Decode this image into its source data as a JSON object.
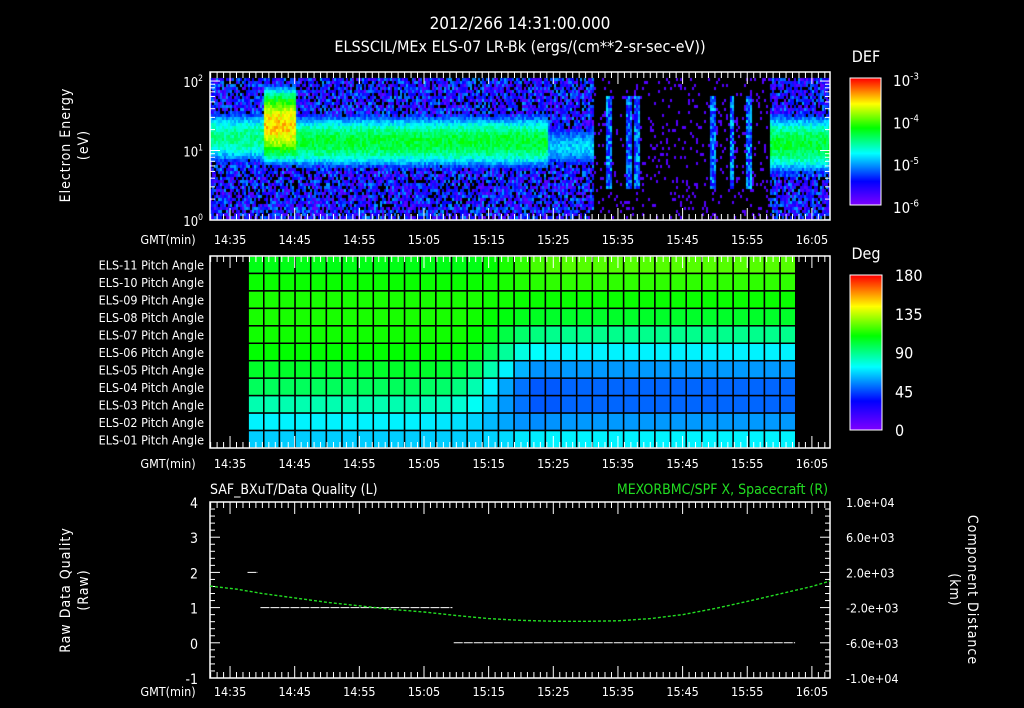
{
  "header": {
    "timestamp": "2012/266 14:31:00.000"
  },
  "colors": {
    "background": "#000000",
    "axis": "#ffffff",
    "spacecraft_line": "#22dd22",
    "quality_line": "#ffffff"
  },
  "time_axis": {
    "label": "GMT(min)",
    "range_min": [
      871.9,
      967.8
    ],
    "ticks": [
      {
        "value": 875,
        "label": "14:35"
      },
      {
        "value": 885,
        "label": "14:45"
      },
      {
        "value": 895,
        "label": "14:55"
      },
      {
        "value": 905,
        "label": "15:05"
      },
      {
        "value": 915,
        "label": "15:15"
      },
      {
        "value": 925,
        "label": "15:25"
      },
      {
        "value": 935,
        "label": "15:35"
      },
      {
        "value": 945,
        "label": "15:45"
      },
      {
        "value": 955,
        "label": "15:55"
      },
      {
        "value": 965,
        "label": "16:05"
      }
    ]
  },
  "chart_data": [
    {
      "type": "heatmap",
      "title": "ELSSCIL/MEx ELS-07 LR-Bk  (ergs/(cm**2-sr-sec-eV))",
      "ylabel": [
        "Electron Energy",
        "(eV)"
      ],
      "y_scale": "log",
      "y_range": [
        1,
        135
      ],
      "y_ticks": [
        {
          "value": 1,
          "base": "10",
          "exp": "0"
        },
        {
          "value": 10,
          "base": "10",
          "exp": "1"
        },
        {
          "value": 100,
          "base": "10",
          "exp": "2"
        }
      ],
      "colorbar": {
        "label": "DEF",
        "scale": "log",
        "range_log10": [
          -6,
          -3
        ],
        "ticks": [
          {
            "value": -3,
            "base": "10",
            "exp": "-3"
          },
          {
            "value": -4,
            "base": "10",
            "exp": "-4"
          },
          {
            "value": -5,
            "base": "10",
            "exp": "-5"
          },
          {
            "value": -6,
            "base": "10",
            "exp": "-6"
          }
        ]
      },
      "band_segments": [
        {
          "t": [
            871.9,
            880
          ],
          "peak_log_def": -4.5,
          "center_eV": 16,
          "width_dec": 0.28
        },
        {
          "t": [
            880,
            885
          ],
          "peak_log_def": -3.5,
          "center_eV": 24,
          "width_dec": 0.32
        },
        {
          "t": [
            885,
            924
          ],
          "peak_log_def": -4.3,
          "center_eV": 14,
          "width_dec": 0.27
        },
        {
          "t": [
            924,
            931
          ],
          "peak_log_def": -4.9,
          "center_eV": 12,
          "width_dec": 0.25
        },
        {
          "t": [
            958.5,
            967.8
          ],
          "peak_log_def": -4.3,
          "center_eV": 13,
          "width_dec": 0.3
        }
      ],
      "quiet_interval": [
        931,
        958.5
      ],
      "streaks_min": [
        933.5,
        936.5,
        937.8,
        949.5,
        952.5,
        955.2
      ]
    },
    {
      "type": "heatmap",
      "colorbar": {
        "label": "Deg",
        "range": [
          0,
          180
        ],
        "ticks": [
          "180",
          "135",
          "90",
          "45",
          "0"
        ]
      },
      "time_start_min": 877.8,
      "time_step_min": 2.42,
      "rows": [
        {
          "label": "ELS-11 Pitch Angle",
          "values": [
            107,
            107,
            107,
            107,
            107,
            107,
            107,
            107,
            107,
            107,
            107,
            107,
            107,
            107,
            107,
            110,
            113,
            116,
            119,
            121,
            121,
            121,
            121,
            121,
            121,
            121,
            121,
            121,
            121,
            121,
            121,
            121,
            121,
            121,
            121
          ]
        },
        {
          "label": "ELS-10 Pitch Angle",
          "values": [
            111,
            111,
            111,
            111,
            111,
            111,
            111,
            111,
            111,
            111,
            111,
            111,
            111,
            111,
            111,
            112,
            113,
            114,
            115,
            116,
            116,
            116,
            116,
            116,
            116,
            116,
            116,
            116,
            116,
            116,
            116,
            116,
            116,
            116,
            116
          ]
        },
        {
          "label": "ELS-09 Pitch Angle",
          "values": [
            113,
            113,
            113,
            113,
            113,
            113,
            113,
            113,
            113,
            113,
            113,
            113,
            113,
            113,
            113,
            112,
            112,
            111,
            111,
            111,
            111,
            111,
            111,
            111,
            111,
            111,
            111,
            111,
            111,
            111,
            111,
            111,
            111,
            111,
            111
          ]
        },
        {
          "label": "ELS-08 Pitch Angle",
          "values": [
            113,
            113,
            113,
            113,
            113,
            113,
            113,
            113,
            113,
            113,
            113,
            113,
            113,
            113,
            112,
            110,
            108,
            106,
            105,
            104,
            104,
            104,
            104,
            104,
            104,
            104,
            104,
            104,
            104,
            104,
            104,
            104,
            104,
            104,
            104
          ]
        },
        {
          "label": "ELS-07 Pitch Angle",
          "values": [
            112,
            112,
            112,
            112,
            112,
            112,
            112,
            112,
            112,
            112,
            112,
            112,
            112,
            112,
            110,
            106,
            100,
            95,
            92,
            90,
            90,
            90,
            90,
            90,
            90,
            90,
            90,
            90,
            90,
            90,
            90,
            90,
            90,
            90,
            90
          ]
        },
        {
          "label": "ELS-06 Pitch Angle",
          "values": [
            110,
            110,
            110,
            110,
            110,
            110,
            110,
            110,
            110,
            110,
            110,
            110,
            110,
            109,
            106,
            98,
            88,
            78,
            74,
            72,
            72,
            72,
            72,
            72,
            72,
            72,
            72,
            72,
            72,
            72,
            72,
            72,
            72,
            72,
            72
          ]
        },
        {
          "label": "ELS-05 Pitch Angle",
          "values": [
            104,
            104,
            104,
            104,
            104,
            104,
            104,
            104,
            104,
            104,
            104,
            104,
            103,
            101,
            96,
            85,
            72,
            62,
            57,
            57,
            58,
            58,
            58,
            58,
            58,
            58,
            58,
            58,
            58,
            58,
            58,
            58,
            58,
            58,
            58
          ]
        },
        {
          "label": "ELS-04 Pitch Angle",
          "values": [
            97,
            97,
            97,
            97,
            97,
            97,
            97,
            97,
            97,
            97,
            97,
            96,
            95,
            92,
            85,
            72,
            60,
            52,
            48,
            48,
            50,
            50,
            50,
            50,
            50,
            50,
            50,
            50,
            50,
            50,
            50,
            50,
            50,
            50,
            50
          ]
        },
        {
          "label": "ELS-03 Pitch Angle",
          "values": [
            85,
            85,
            85,
            85,
            85,
            85,
            85,
            85,
            85,
            85,
            85,
            84,
            83,
            80,
            75,
            66,
            58,
            52,
            48,
            48,
            50,
            50,
            50,
            50,
            50,
            50,
            50,
            50,
            50,
            50,
            50,
            50,
            50,
            50,
            50
          ]
        },
        {
          "label": "ELS-02 Pitch Angle",
          "values": [
            72,
            72,
            72,
            72,
            72,
            72,
            72,
            72,
            72,
            72,
            72,
            71,
            70,
            69,
            67,
            63,
            60,
            57,
            56,
            57,
            58,
            58,
            58,
            58,
            58,
            58,
            58,
            58,
            58,
            58,
            58,
            58,
            58,
            58,
            58
          ]
        },
        {
          "label": "ELS-01 Pitch Angle",
          "values": [
            66,
            66,
            66,
            66,
            66,
            66,
            66,
            66,
            66,
            66,
            66,
            66,
            66,
            66,
            66,
            67,
            68,
            70,
            71,
            72,
            72,
            72,
            72,
            72,
            72,
            72,
            72,
            72,
            72,
            72,
            72,
            72,
            72,
            72,
            72
          ]
        }
      ]
    },
    {
      "type": "line",
      "title_left": "SAF_BXuT/Data Quality (L)",
      "title_right": "MEXORBMC/SPF X, Spacecraft (R)",
      "ylabel_left": [
        "Raw Data Quality",
        "(Raw)"
      ],
      "ylabel_right": [
        "Component Distance",
        "(km)"
      ],
      "y_left_range": [
        -1,
        4
      ],
      "y_left_ticks": [
        "4",
        "3",
        "2",
        "1",
        "0",
        "-1"
      ],
      "y_right_range": [
        -10000,
        10000
      ],
      "y_right_ticks": [
        "1.0e+04",
        "6.0e+03",
        "2.0e+03",
        "-2.0e+03",
        "-6.0e+03",
        "-1.0e+04"
      ],
      "quality_segments": [
        {
          "t": [
            877.7,
            879.3
          ],
          "value": 2
        },
        {
          "t": [
            879.7,
            909.4
          ],
          "value": 1
        },
        {
          "t": [
            909.6,
            962.4
          ],
          "value": 0
        }
      ],
      "spacecraft_x": {
        "t": [
          871.9,
          876,
          880,
          885,
          890,
          895,
          900,
          905,
          910,
          915,
          920,
          925,
          930,
          935,
          940,
          945,
          950,
          955,
          960,
          965,
          967.8
        ],
        "km": [
          440,
          100,
          -400,
          -900,
          -1400,
          -1800,
          -2200,
          -2500,
          -2900,
          -3250,
          -3450,
          -3550,
          -3560,
          -3500,
          -3250,
          -2800,
          -2100,
          -1300,
          -450,
          400,
          1020
        ]
      }
    }
  ]
}
